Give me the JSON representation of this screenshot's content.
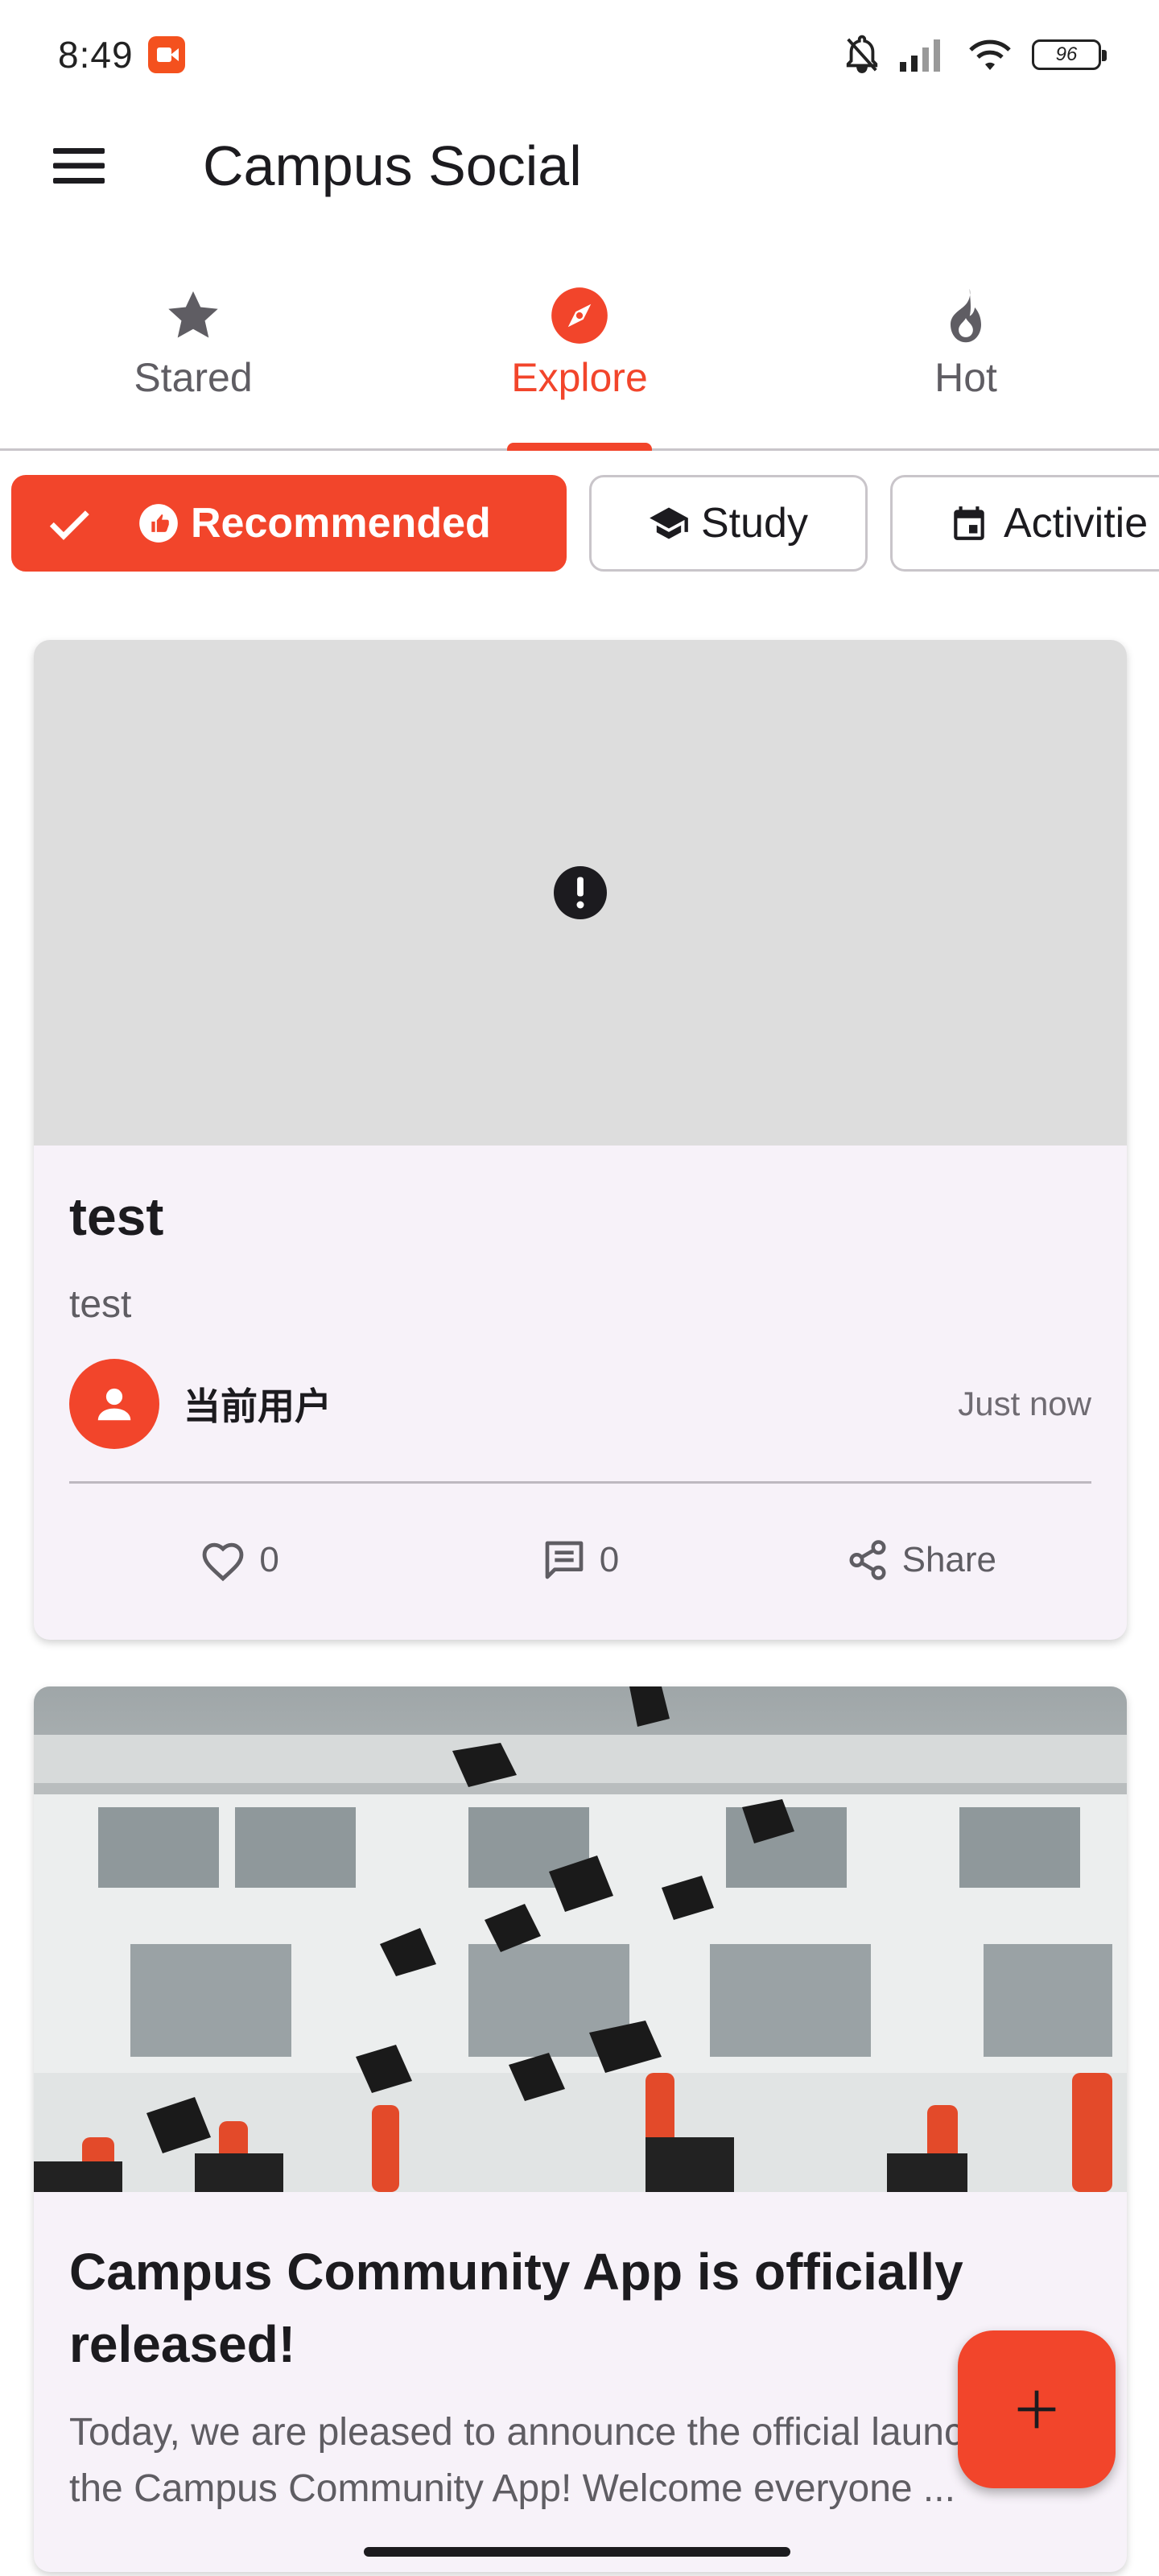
{
  "status_bar": {
    "time": "8:49",
    "battery": "96"
  },
  "app_bar": {
    "title": "Campus Social"
  },
  "tabs": [
    {
      "label": "Stared",
      "icon": "star-icon",
      "active": false
    },
    {
      "label": "Explore",
      "icon": "compass-icon",
      "active": true
    },
    {
      "label": "Hot",
      "icon": "flame-icon",
      "active": false
    }
  ],
  "filter_chips": [
    {
      "label": "Recommended",
      "icon": "recommend-icon",
      "selected": true
    },
    {
      "label": "Study",
      "icon": "school-icon",
      "selected": false
    },
    {
      "label": "Activitie",
      "icon": "event-icon",
      "selected": false
    }
  ],
  "posts": [
    {
      "title": "test",
      "text": "test",
      "author": "当前用户",
      "time": "Just now",
      "likes": "0",
      "comments": "0",
      "share_label": "Share"
    },
    {
      "title": "Campus Community App is officially released!",
      "excerpt": "Today, we are pleased to announce the official launch of the Campus Community App! Welcome everyone ..."
    }
  ],
  "colors": {
    "accent": "#f2452b",
    "card_background": "#f7f2f9",
    "placeholder": "#dddddd"
  }
}
